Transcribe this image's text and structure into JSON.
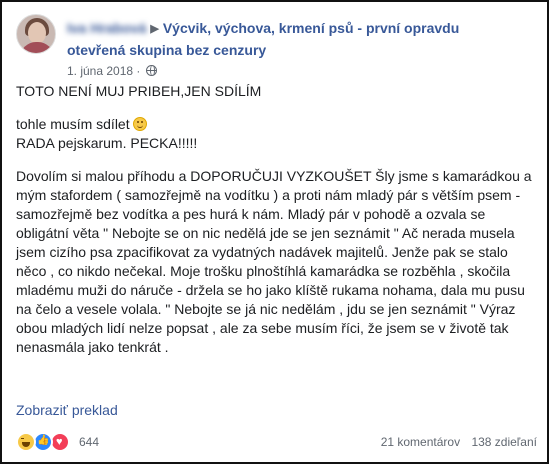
{
  "post": {
    "author": "Iva Hrabová",
    "group_name_part1": "Výcvik, výchova, krmení psů - první opravdu",
    "group_name_part2": "otevřená skupina bez cenzury",
    "date": "1. júna 2018",
    "separator": "·",
    "privacy_icon": "globe-icon",
    "paragraph1": "TOTO NENÍ MUJ PRIBEH,JEN SDÍLÍM",
    "line2a": "tohle musím sdílet",
    "emoji": "slightly-smiling-face-icon",
    "line2b": "RADA pejskarum. PECKA!!!!!",
    "paragraph3": "Dovolím si malou příhodu a DOPORUČUJI VYZKOUŠET Šly jsme s kamarádkou a mým stafordem ( samozřejmě na vodítku ) a proti nám mladý pár s větším psem - samozřejmě bez vodítka a pes hurá k nám. Mladý pár v pohodě a ozvala se obligátní věta \" Nebojte se on nic nedělá jde se jen seznámit \" Ač nerada musela jsem cizího psa zpacifikovat za vydatných nadávek majitelů. Jenže pak se stalo něco , co nikdo nečekal. Moje trošku plnoštíhlá kamarádka se rozběhla , skočila mladému muži do náruče - držela se ho jako klíště rukama nohama, dala mu pusu na čelo a vesele volala. \" Nebojte se já nic nedělám , jdu se jen seznámit \" Výraz obou mladých lidí nelze popsat , ale za sebe musím říci, že jsem se v životě tak nenasmála jako tenkrát .",
    "translate_link": "Zobraziť preklad"
  },
  "footer": {
    "reactions": [
      "haha-icon",
      "like-icon",
      "love-icon"
    ],
    "reaction_count": "644",
    "comments": "21 komentárov",
    "shares": "138 zdieľaní"
  },
  "colors": {
    "link": "#385898",
    "text": "#1c1e21",
    "meta": "#606770"
  }
}
